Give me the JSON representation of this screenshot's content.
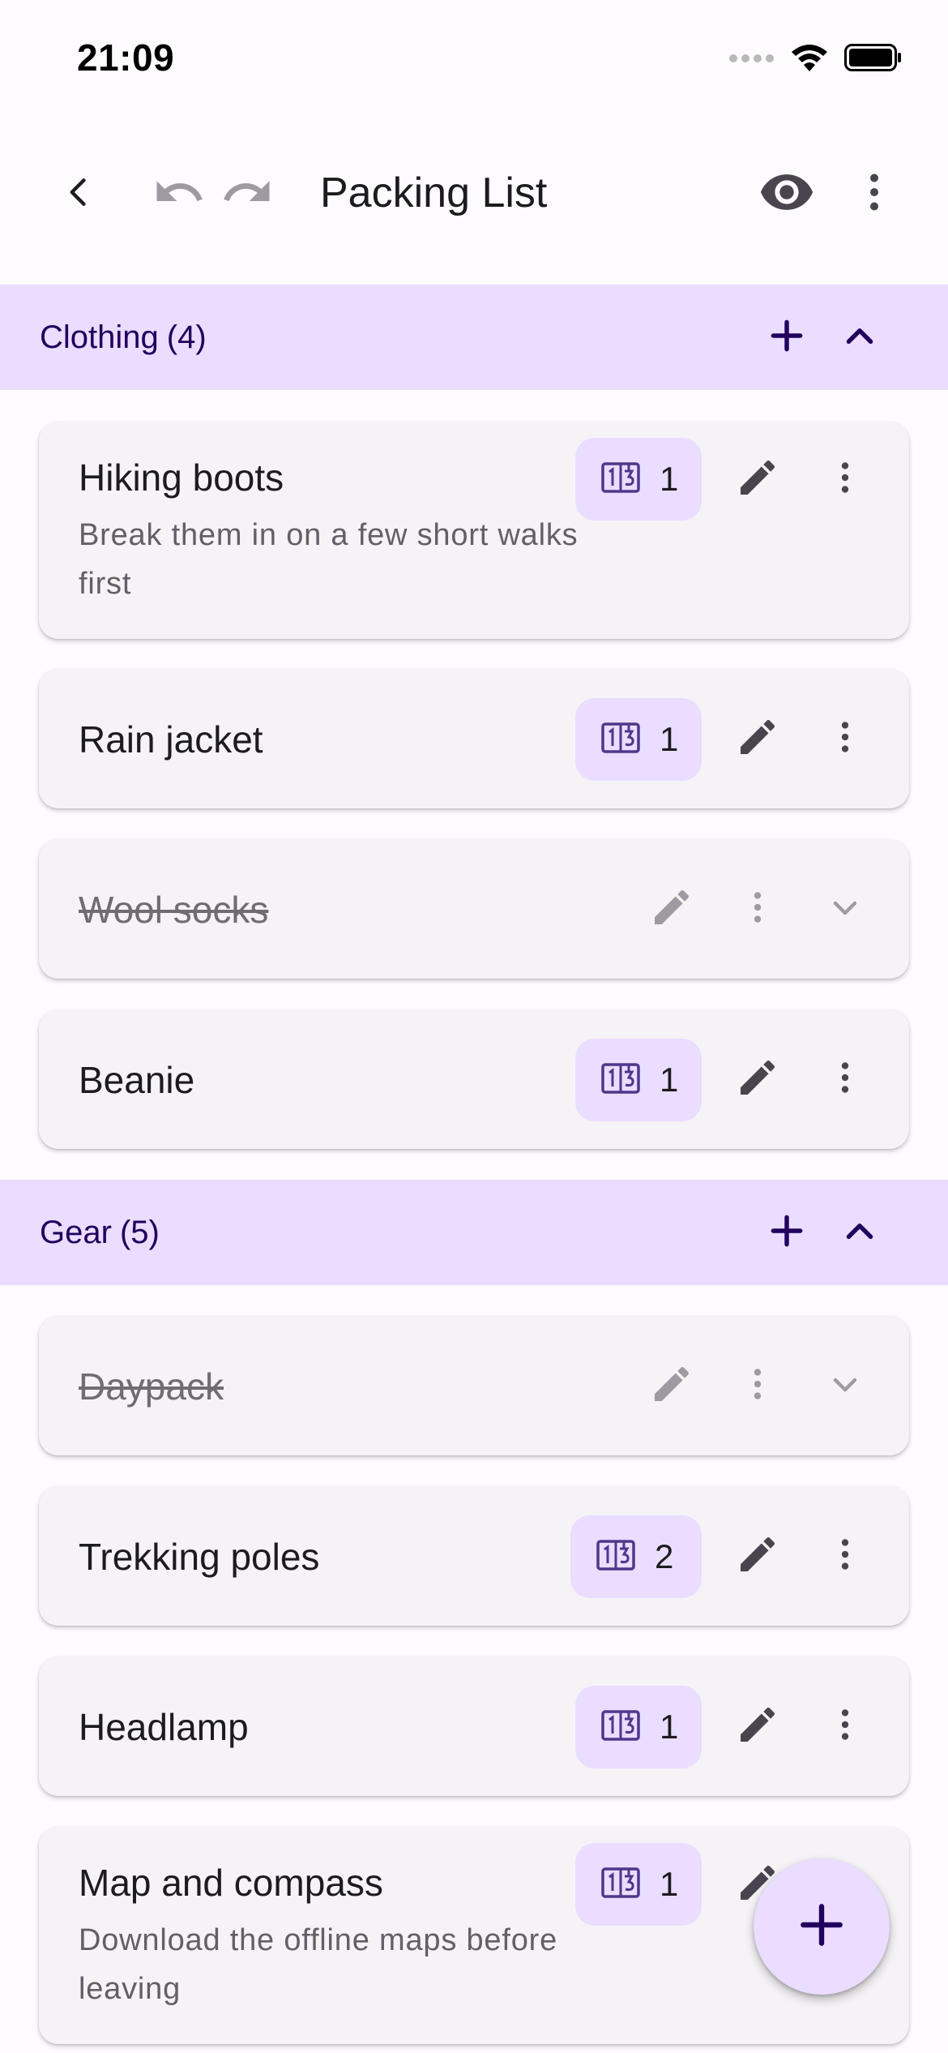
{
  "status_bar": {
    "time": "21:09",
    "icons": [
      "signal-dots-icon",
      "wifi-icon",
      "battery-icon"
    ]
  },
  "app_bar": {
    "title": "Packing List",
    "icons": [
      "back-arrow-icon",
      "undo-icon",
      "redo-icon",
      "eye-icon",
      "more-vert-icon"
    ]
  },
  "colors": {
    "section_bg": "#EADDFF",
    "section_text": "#21005D",
    "card_bg": "#F6F3F7",
    "chip_bg": "#EADDFF",
    "chip_icon": "#4F378B",
    "fab_bg": "#EADDFF",
    "icon_active": "#48454E",
    "icon_disabled": "#9E9AA2"
  },
  "sections": [
    {
      "title": "Clothing",
      "count": "(4)",
      "items": [
        {
          "name": "Hiking boots",
          "note": "Break them in on a few short walks first",
          "quantity": "1",
          "checked": false
        },
        {
          "name": "Rain jacket",
          "note": "",
          "quantity": "1",
          "checked": false
        },
        {
          "name": "Wool socks",
          "note": "",
          "quantity": "",
          "checked": true
        },
        {
          "name": "Beanie",
          "note": "",
          "quantity": "1",
          "checked": false
        }
      ]
    },
    {
      "title": "Gear",
      "count": "(5)",
      "items": [
        {
          "name": "Daypack",
          "note": "",
          "quantity": "",
          "checked": true
        },
        {
          "name": "Trekking poles",
          "note": "",
          "quantity": "2",
          "checked": false
        },
        {
          "name": "Headlamp",
          "note": "",
          "quantity": "1",
          "checked": false
        },
        {
          "name": "Map and compass",
          "note": "Download the offline maps before leaving",
          "quantity": "1",
          "checked": false
        }
      ]
    }
  ]
}
